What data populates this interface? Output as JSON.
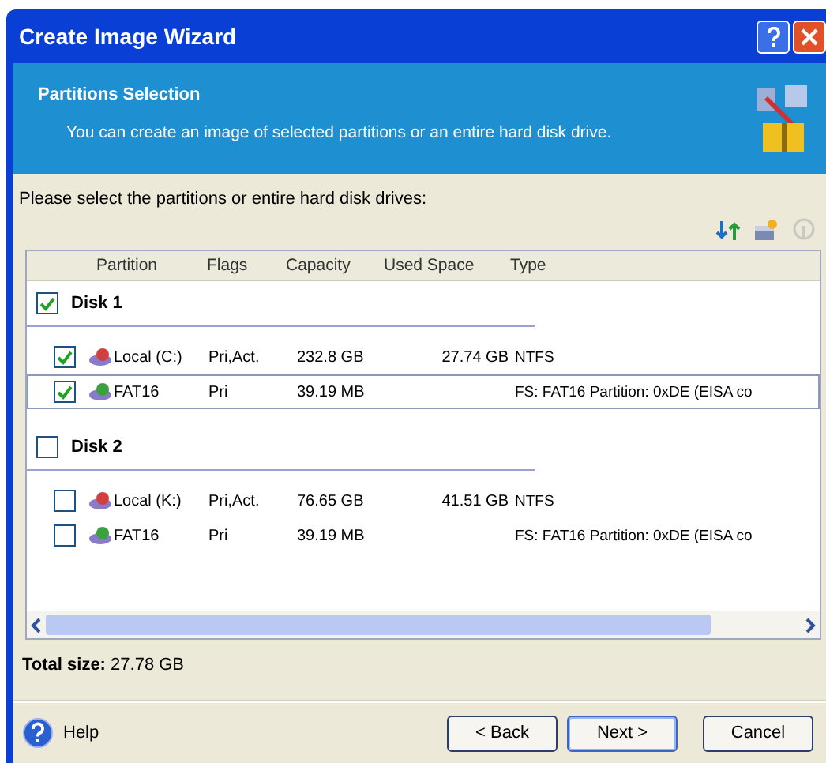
{
  "window": {
    "title": "Create Image Wizard"
  },
  "header": {
    "title": "Partitions Selection",
    "subtitle": "You can create an image of selected partitions or an entire hard disk drive."
  },
  "instruction": "Please select the partitions or entire hard disk drives:",
  "toolbar": [
    {
      "kind": "arrows",
      "disabled": false
    },
    {
      "kind": "disk",
      "disabled": false
    },
    {
      "kind": "info",
      "disabled": true
    }
  ],
  "table": {
    "columns": [
      "Partition",
      "Flags",
      "Capacity",
      "Used Space",
      "Type"
    ],
    "disks": [
      {
        "name": "Disk 1",
        "checked": true,
        "partitions": [
          {
            "name": "Local (C:)",
            "flags": "Pri,Act.",
            "capacity": "232.8 GB",
            "used": "27.74 GB",
            "type": "NTFS",
            "checked": true,
            "selected": false,
            "color": "#d04040"
          },
          {
            "name": "FAT16",
            "flags": "Pri",
            "capacity": "39.19 MB",
            "type": "FS: FAT16 Partition: 0xDE (EISA co",
            "checked": true,
            "selected": true,
            "color": "#3aa040"
          }
        ]
      },
      {
        "name": "Disk 2",
        "checked": false,
        "partitions": [
          {
            "name": "Local (K:)",
            "flags": "Pri,Act.",
            "capacity": "76.65 GB",
            "used": "41.51 GB",
            "type": "NTFS",
            "checked": false,
            "selected": false,
            "color": "#d04040"
          },
          {
            "name": "FAT16",
            "flags": "Pri",
            "capacity": "39.19 MB",
            "type": "FS: FAT16 Partition: 0xDE (EISA co",
            "checked": false,
            "selected": false,
            "color": "#3aa040"
          }
        ]
      }
    ]
  },
  "total": {
    "label": "Total size:",
    "value": "27.78 GB"
  },
  "help": "Help",
  "buttons": [
    "< Back",
    "Next >",
    "Cancel"
  ]
}
